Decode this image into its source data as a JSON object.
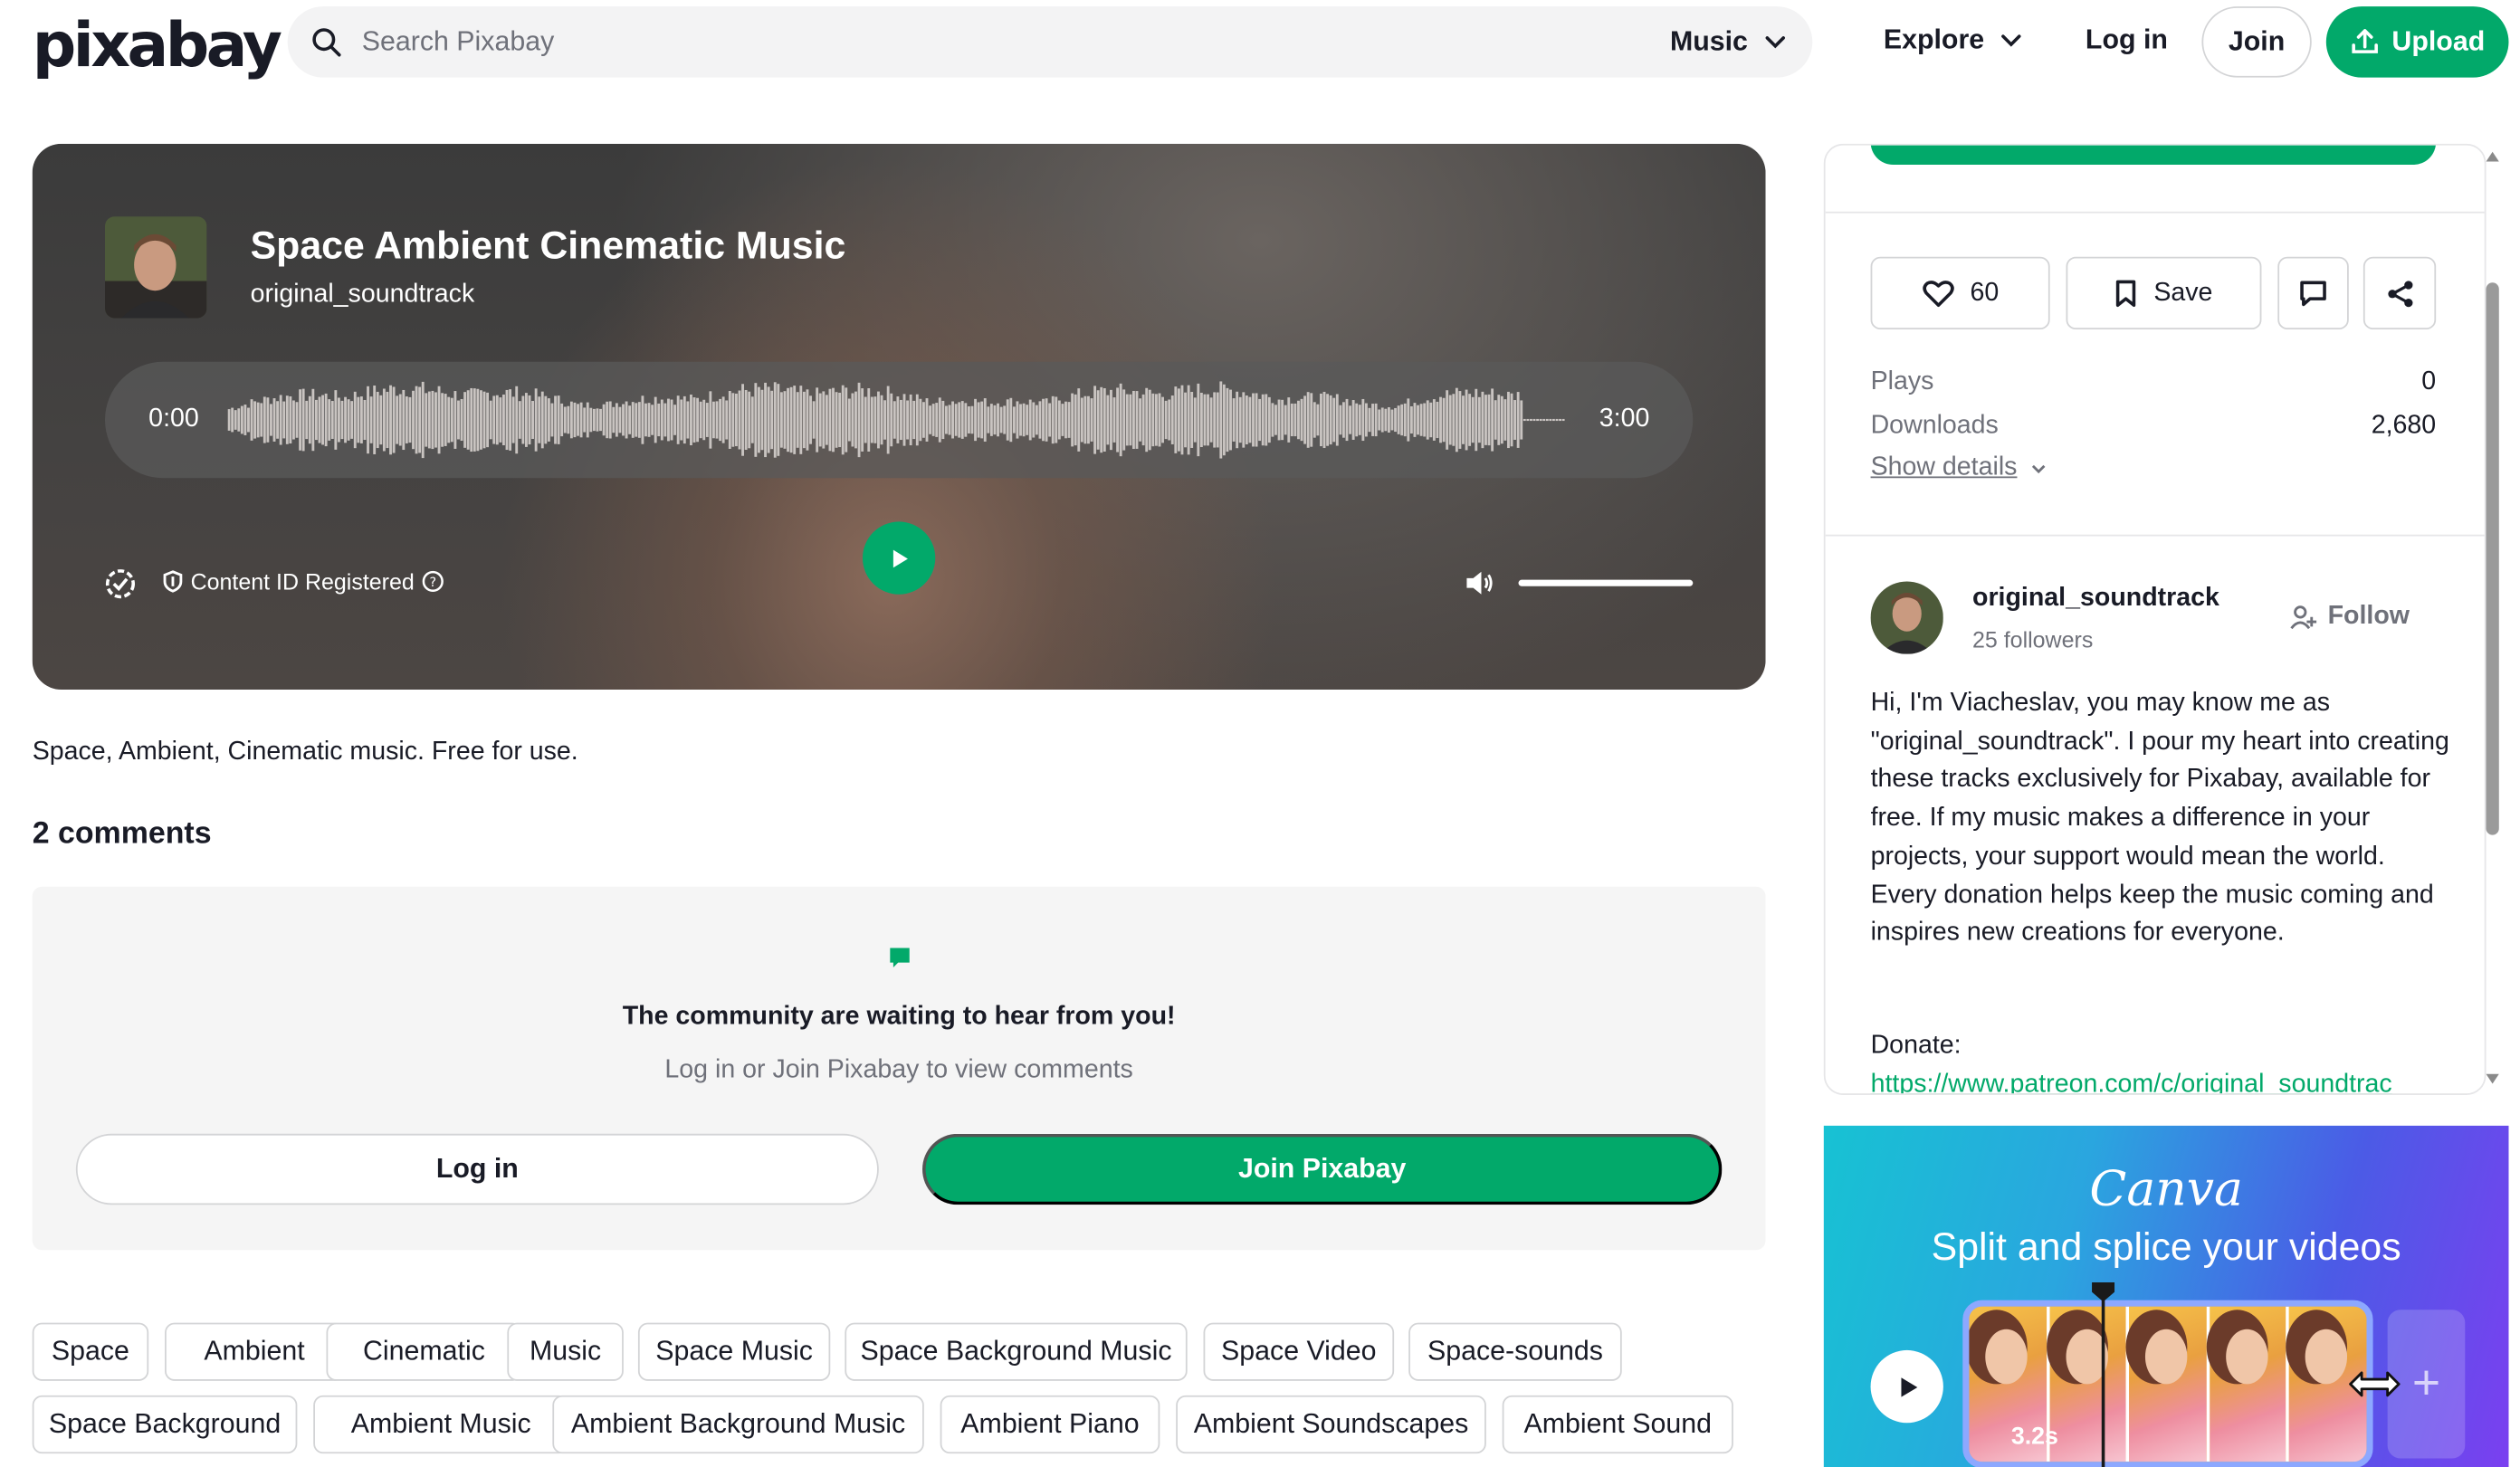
{
  "header": {
    "logo": "pixabay",
    "search_placeholder": "Search Pixabay",
    "category": "Music",
    "explore": "Explore",
    "login": "Log in",
    "join": "Join",
    "upload": "Upload"
  },
  "player": {
    "title": "Space Ambient Cinematic Music",
    "artist": "original_soundtrack",
    "time_current": "0:00",
    "time_total": "3:00",
    "content_id": "Content ID Registered",
    "progress": 0,
    "volume": 1.0
  },
  "description": "Space, Ambient, Cinematic music. Free for use.",
  "comments": {
    "heading": "2 comments",
    "prompt_title": "The community are waiting to hear from you!",
    "prompt_sub": "Log in or Join Pixabay to view comments",
    "login_button": "Log in",
    "join_button": "Join Pixabay"
  },
  "tags": {
    "row1": [
      "Space",
      "Ambient",
      "Cinematic",
      "Music",
      "Space Music",
      "Space Background Music",
      "Space Video",
      "Space-sounds"
    ],
    "row2": [
      "Space Background",
      "Ambient Music",
      "Ambient Background Music",
      "Ambient Piano",
      "Ambient Soundscapes",
      "Ambient Sound"
    ]
  },
  "sidebar": {
    "likes": "60",
    "save": "Save",
    "stats": [
      {
        "label": "Plays",
        "value": "0"
      },
      {
        "label": "Downloads",
        "value": "2,680"
      }
    ],
    "show_details": "Show details",
    "user": {
      "name": "original_soundtrack",
      "followers": "25 followers",
      "follow": "Follow"
    },
    "bio": "Hi, I'm Viacheslav, you may know me as \"original_soundtrack\". I pour my heart into creating these tracks exclusively for Pixabay, available for free. If my music makes a difference in your projects, your support would mean the world. Every donation helps keep the music coming and inspires new creations for everyone.",
    "donate_label": "Donate:",
    "donate_link": "https://www.patreon.com/c/original_soundtrac"
  },
  "ad": {
    "brand": "Canva",
    "tagline": "Split and splice your videos",
    "duration": "3.2s"
  },
  "colors": {
    "accent": "#02a96a",
    "text": "#191b26",
    "muted": "#6f717a"
  }
}
